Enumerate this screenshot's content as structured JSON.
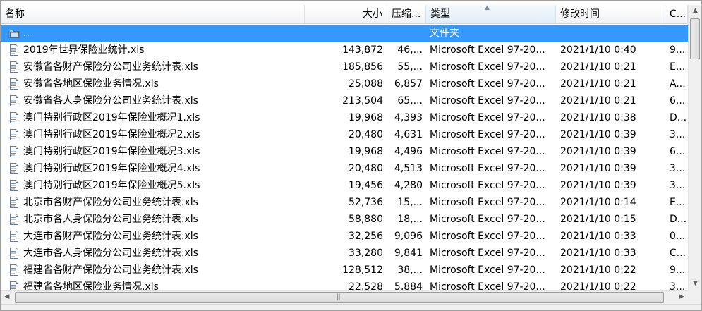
{
  "columns": {
    "name": "名称",
    "size": "大小",
    "packed": "压缩...",
    "type": "类型",
    "modified": "修改时间",
    "crc": "C..."
  },
  "sort": {
    "column": "type",
    "direction": "ascending"
  },
  "selection_color": "#3399ff",
  "rows": [
    {
      "name": "..",
      "size": "",
      "packed": "",
      "type": "文件夹",
      "modified": "",
      "crc": "",
      "icon": "folder-up-icon",
      "selected": true
    },
    {
      "name": "2019年世界保险业统计.xls",
      "size": "143,872",
      "packed": "46,...",
      "type": "Microsoft Excel 97-20...",
      "modified": "2021/1/10 0:40",
      "crc": "9...",
      "icon": "xls-file-icon"
    },
    {
      "name": "安徽省各财产保险分公司业务统计表.xls",
      "size": "185,856",
      "packed": "55,...",
      "type": "Microsoft Excel 97-20...",
      "modified": "2021/1/10 0:21",
      "crc": "E...",
      "icon": "xls-file-icon"
    },
    {
      "name": "安徽省各地区保险业务情况.xls",
      "size": "25,088",
      "packed": "6,857",
      "type": "Microsoft Excel 97-20...",
      "modified": "2021/1/10 0:21",
      "crc": "A...",
      "icon": "xls-file-icon"
    },
    {
      "name": "安徽省各人身保险分公司业务统计表.xls",
      "size": "213,504",
      "packed": "65,...",
      "type": "Microsoft Excel 97-20...",
      "modified": "2021/1/10 0:21",
      "crc": "6...",
      "icon": "xls-file-icon"
    },
    {
      "name": "澳门特别行政区2019年保险业概况1.xls",
      "size": "19,968",
      "packed": "4,393",
      "type": "Microsoft Excel 97-20...",
      "modified": "2021/1/10 0:38",
      "crc": "D...",
      "icon": "xls-file-icon"
    },
    {
      "name": "澳门特别行政区2019年保险业概况2.xls",
      "size": "20,480",
      "packed": "4,631",
      "type": "Microsoft Excel 97-20...",
      "modified": "2021/1/10 0:39",
      "crc": "3...",
      "icon": "xls-file-icon"
    },
    {
      "name": "澳门特别行政区2019年保险业概况3.xls",
      "size": "19,968",
      "packed": "4,496",
      "type": "Microsoft Excel 97-20...",
      "modified": "2021/1/10 0:39",
      "crc": "6...",
      "icon": "xls-file-icon"
    },
    {
      "name": "澳门特别行政区2019年保险业概况4.xls",
      "size": "20,480",
      "packed": "4,513",
      "type": "Microsoft Excel 97-20...",
      "modified": "2021/1/10 0:39",
      "crc": "3...",
      "icon": "xls-file-icon"
    },
    {
      "name": "澳门特别行政区2019年保险业概况5.xls",
      "size": "19,456",
      "packed": "4,280",
      "type": "Microsoft Excel 97-20...",
      "modified": "2021/1/10 0:39",
      "crc": "3...",
      "icon": "xls-file-icon"
    },
    {
      "name": "北京市各财产保险分公司业务统计表.xls",
      "size": "52,736",
      "packed": "15,...",
      "type": "Microsoft Excel 97-20...",
      "modified": "2021/1/10 0:14",
      "crc": "E...",
      "icon": "xls-file-icon"
    },
    {
      "name": "北京市各人身保险分公司业务统计表.xls",
      "size": "58,880",
      "packed": "18,...",
      "type": "Microsoft Excel 97-20...",
      "modified": "2021/1/10 0:15",
      "crc": "D...",
      "icon": "xls-file-icon"
    },
    {
      "name": "大连市各财产保险分公司业务统计表.xls",
      "size": "32,256",
      "packed": "9,096",
      "type": "Microsoft Excel 97-20...",
      "modified": "2021/1/10 0:33",
      "crc": "0...",
      "icon": "xls-file-icon"
    },
    {
      "name": "大连市各人身保险分公司业务统计表.xls",
      "size": "33,280",
      "packed": "9,841",
      "type": "Microsoft Excel 97-20...",
      "modified": "2021/1/10 0:33",
      "crc": "C...",
      "icon": "xls-file-icon"
    },
    {
      "name": "福建省各财产保险分公司业务统计表.xls",
      "size": "128,512",
      "packed": "38,...",
      "type": "Microsoft Excel 97-20...",
      "modified": "2021/1/10 0:22",
      "crc": "9...",
      "icon": "xls-file-icon"
    },
    {
      "name": "福建省各地区保险业务情况.xls",
      "size": "22,528",
      "packed": "5,884",
      "type": "Microsoft Excel 97-20...",
      "modified": "2021/1/10 0:22",
      "crc": "3...",
      "icon": "xls-file-icon"
    }
  ]
}
